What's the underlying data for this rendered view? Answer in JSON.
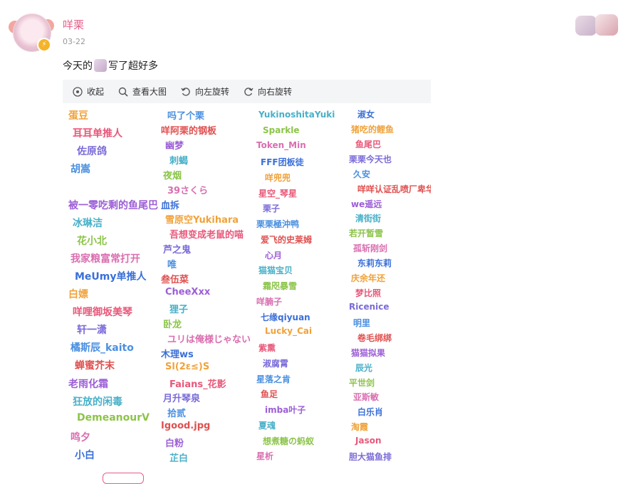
{
  "post": {
    "username": "咩栗",
    "date": "03-22",
    "text_before": "今天的",
    "text_after": "写了超好多"
  },
  "toolbar": {
    "collapse": "收起",
    "view_large": "查看大图",
    "rotate_left": "向左旋转",
    "rotate_right": "向右旋转"
  },
  "signatures": {
    "col1": [
      "蛋豆",
      "耳耳单推人",
      "佐原鸽",
      "胡嵩",
      "",
      "被一零吃剩的鱼尾巴",
      "冰琳洁",
      "花小北",
      "我家粮富常打开",
      "MeUmy单推人",
      "白嫖",
      "咩哩御坂美琴",
      "轩一潇",
      "橘斯辰_kaito",
      "蝉蜜芥末",
      "老雨化霜",
      "狂放的闲毒",
      "DemeanourV",
      "鸣夕",
      "小白"
    ],
    "col2": [
      "吗了个栗",
      "咩阿栗的钢板",
      "幽梦",
      "刺蝎",
      "夜烟",
      "39さくら",
      "血拆",
      "雪原空Yukihara",
      "吾想变成老鼠的喵",
      "芦之鬼",
      "唯",
      "叁伍菜",
      "CheeXxx",
      "狸子",
      "卧龙",
      "ユリは俺様じゃない",
      "木理ws",
      "Sl(2ε≤)S",
      "Faians_花影",
      "月升琴泉",
      "拾贰",
      "Igood.jpg",
      "白粉",
      "芷白"
    ],
    "col3": [
      "YukinoshitaYuki",
      "Sparkle",
      "Token_Min",
      "FFF团板徒",
      "咩兜兜",
      "星空_琴星",
      "栗子",
      "栗栗極沖鸭",
      "爱飞的史莱姆",
      "心月",
      "猫猫宝贝",
      "霜咫暴雪",
      "咩腩子",
      "七缘qiyuan",
      "Lucky_Cai",
      "紫熏",
      "淑腐霄",
      "星落之肯",
      "鱼足",
      "imba叶子",
      "夏魂",
      "想煮糖の蚂蚁",
      "星析"
    ],
    "col4": [
      "淑女",
      "猪吃的鲤鱼",
      "鱼尾巴",
      "栗栗今天也",
      "久安",
      "咩咩认证乱喷厂卑华",
      "we遥远",
      "清街街",
      "若开暂雪",
      "孤斩刚剑",
      "东莉东莉",
      "庆余年还",
      "梦比照",
      "Ricenice",
      "明里",
      "卷毛绑绑",
      "猫猫拟果",
      "辰光",
      "平世剑",
      "亚斯敏",
      "白乐肖",
      "淘霞",
      "Jason",
      "胆大猫鱼排"
    ]
  },
  "colors": {
    "username": "#e45f8a",
    "toolbar_bg": "#f4f5f7",
    "date": "#999999"
  }
}
